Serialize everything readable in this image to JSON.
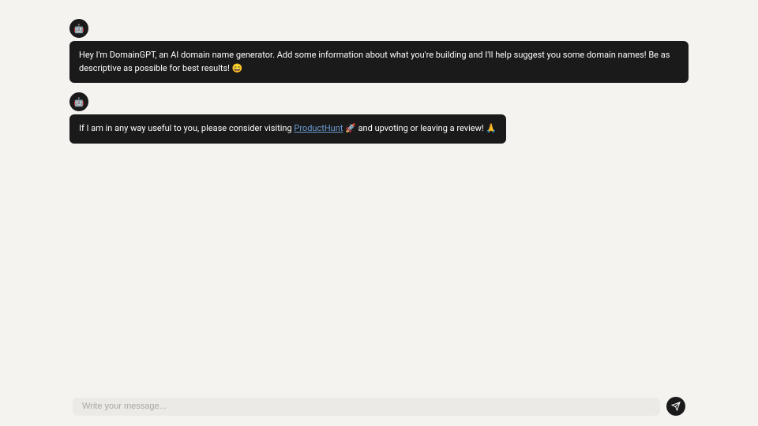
{
  "messages": [
    {
      "avatar": "🤖",
      "text_before_link": "Hey I'm DomainGPT, an AI domain name generator. Add some information about what you're building and I'll help suggest you some domain names! Be as descriptive as possible for best results! 😄",
      "full_width": true
    },
    {
      "avatar": "🤖",
      "text_before_link": "If I am in any way useful to you, please consider visiting ",
      "link_text": "ProductHunt",
      "text_after_link": " 🚀 and upvoting or leaving a review! 🙏",
      "full_width": false
    }
  ],
  "input": {
    "placeholder": "Write your message..."
  },
  "icons": {
    "send": "send-icon"
  }
}
